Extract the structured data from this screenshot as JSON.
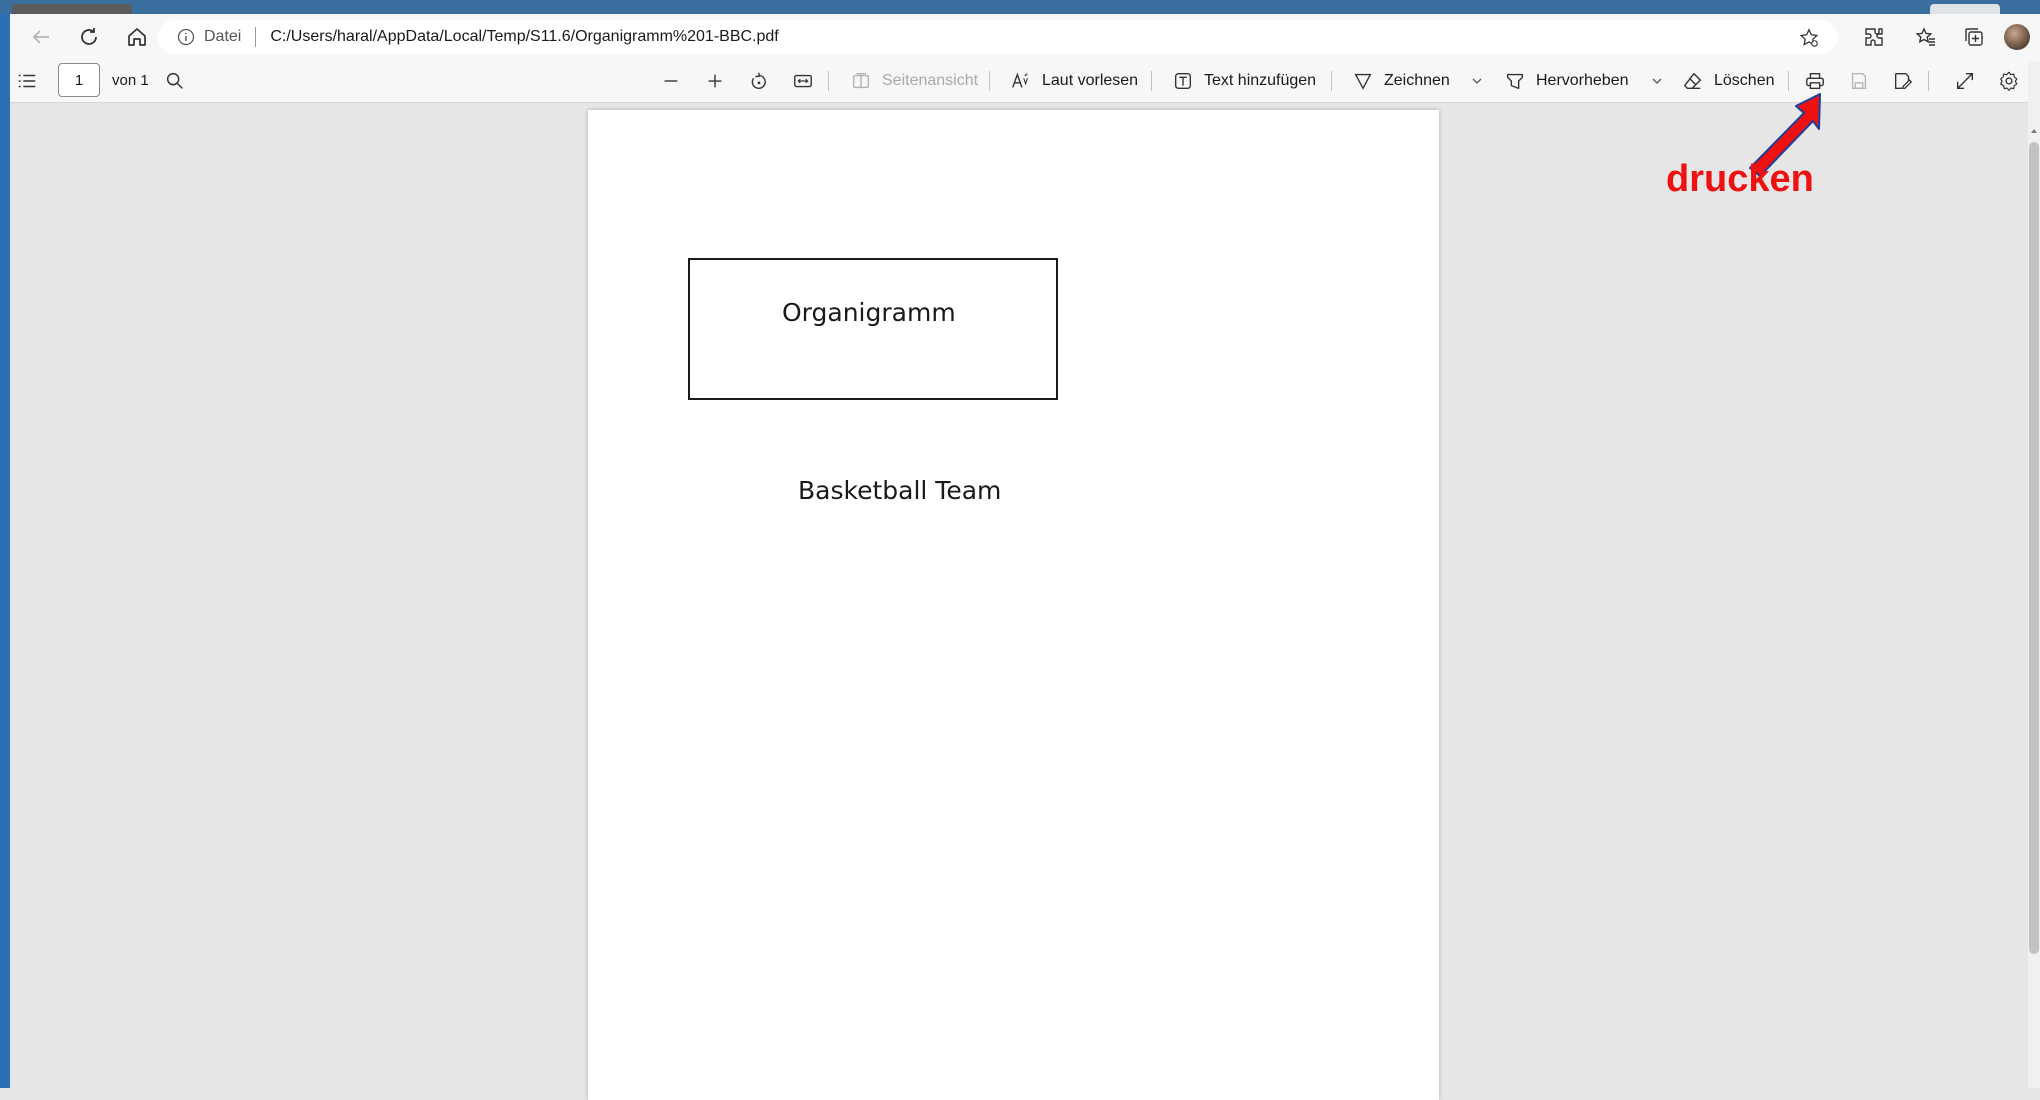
{
  "browser": {
    "address_label": "Datei",
    "address_url": "C:/Users/haral/AppData/Local/Temp/S11.6/Organigramm%201-BBC.pdf",
    "icons": [
      "back-icon",
      "reload-icon",
      "home-icon",
      "info-icon",
      "favorite-star-icon",
      "extensions-icon",
      "favorites-icon",
      "collections-icon",
      "avatar"
    ]
  },
  "pdf_toolbar": {
    "page_current": "1",
    "page_of": "von 1",
    "page_view_label": "Seitenansicht",
    "read_aloud_label": "Laut vorlesen",
    "add_text_label": "Text hinzufügen",
    "draw_label": "Zeichnen",
    "highlight_label": "Hervorheben",
    "erase_label": "Löschen"
  },
  "document": {
    "box_title": "Organigramm",
    "subtitle": "Basketball Team"
  },
  "annotation": {
    "label": "drucken",
    "color": "#ee1111"
  }
}
